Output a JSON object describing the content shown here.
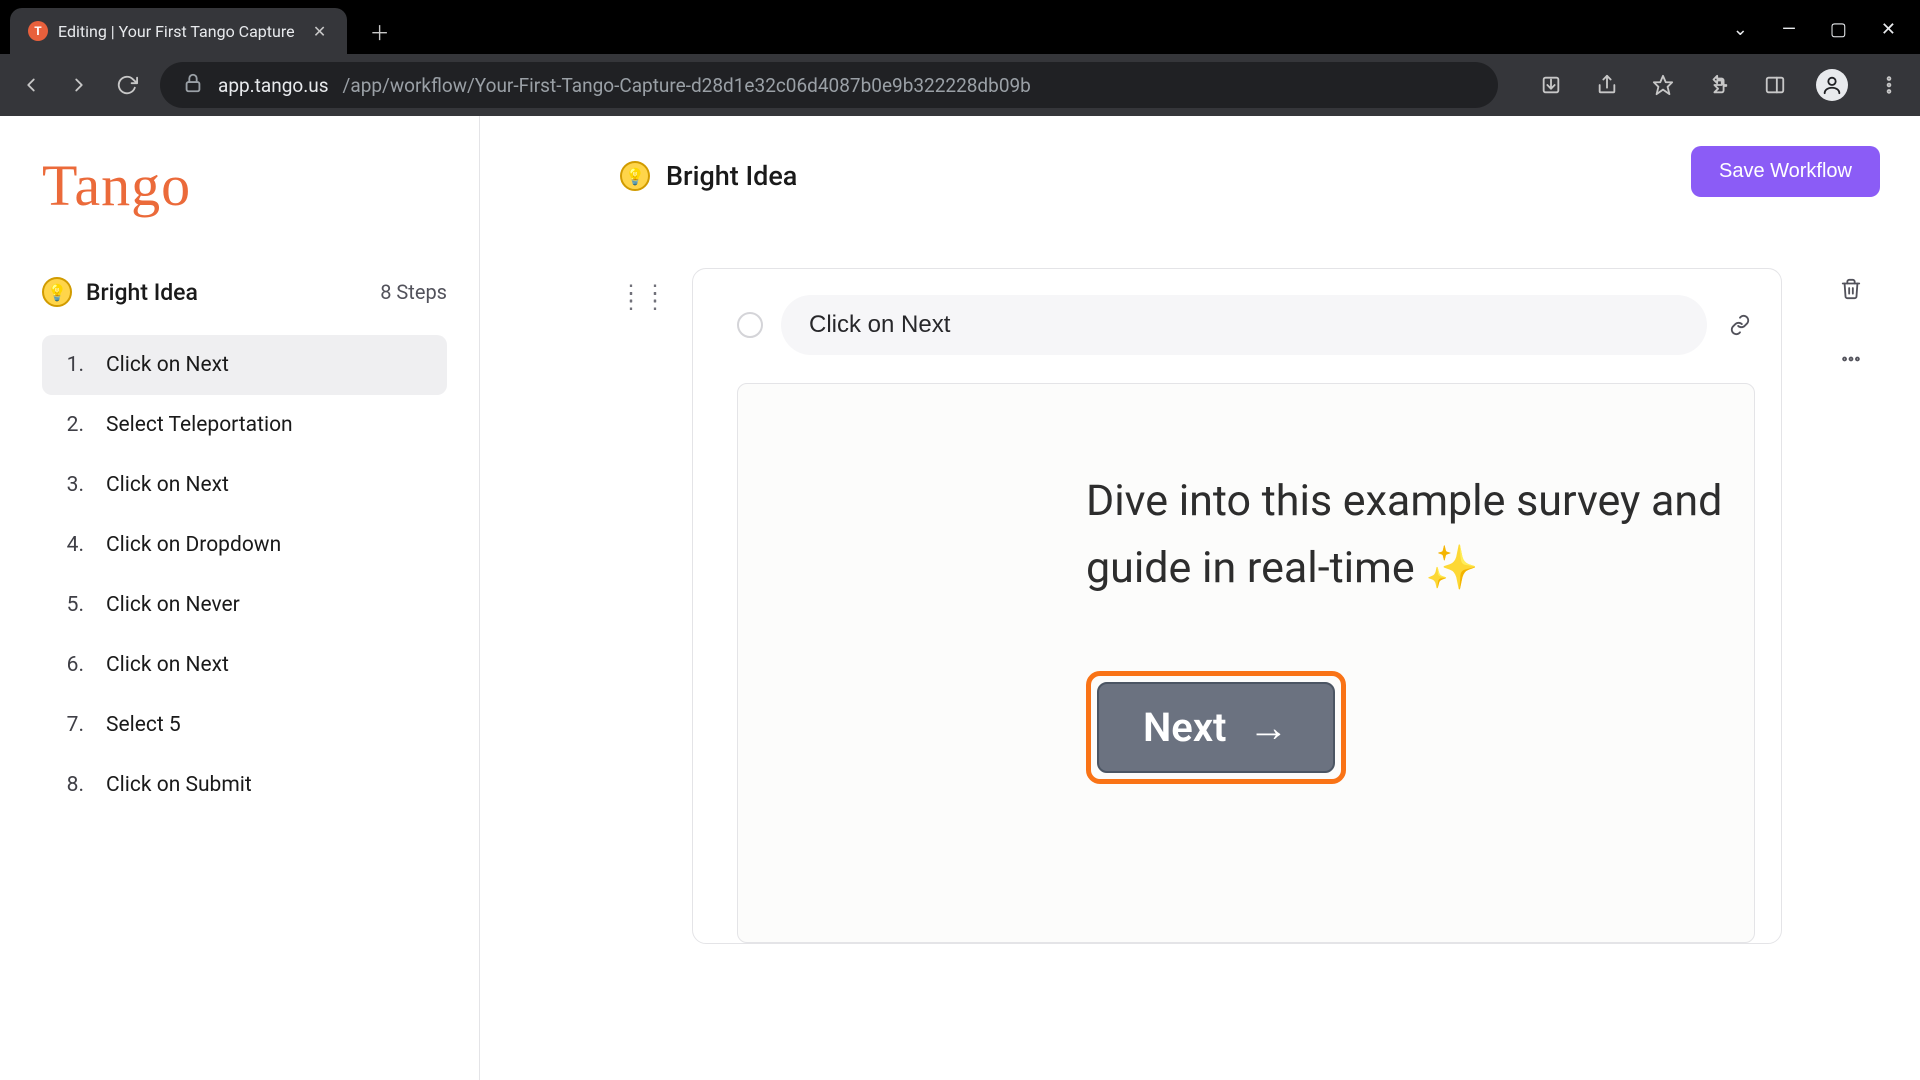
{
  "browser": {
    "tab_title": "Editing | Your First Tango Capture",
    "url_host": "app.tango.us",
    "url_path": "/app/workflow/Your-First-Tango-Capture-d28d1e32c06d4087b0e9b322228db09b"
  },
  "app": {
    "logo_text": "Tango",
    "save_label": "Save Workflow",
    "workflow_title": "Bright Idea",
    "step_count": "8 Steps",
    "steps": [
      {
        "n": "1.",
        "label": "Click on Next",
        "active": true
      },
      {
        "n": "2.",
        "label": "Select Teleportation",
        "active": false
      },
      {
        "n": "3.",
        "label": "Click on Next",
        "active": false
      },
      {
        "n": "4.",
        "label": "Click on Dropdown",
        "active": false
      },
      {
        "n": "5.",
        "label": "Click on Never",
        "active": false
      },
      {
        "n": "6.",
        "label": "Click on Next",
        "active": false
      },
      {
        "n": "7.",
        "label": "Select 5",
        "active": false
      },
      {
        "n": "8.",
        "label": "Click on Submit",
        "active": false
      }
    ],
    "main_title": "Bright Idea",
    "card_title": "Click on Next",
    "screenshot_line1": "Dive into this example survey and",
    "screenshot_line2": "guide in real-time ✨",
    "next_label": "Next"
  }
}
